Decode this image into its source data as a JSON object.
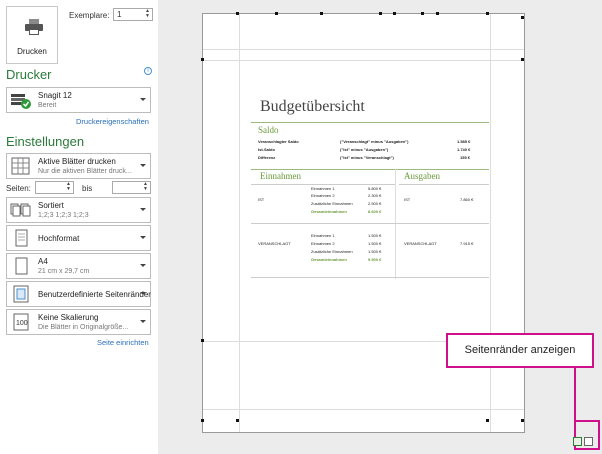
{
  "print": {
    "button_label": "Drucken",
    "copies_label": "Exemplare:",
    "copies_value": "1"
  },
  "printer": {
    "section_title": "Drucker",
    "info_icon": "info-icon",
    "name": "Snagit 12",
    "status": "Bereit",
    "properties_link": "Druckereigenschaften"
  },
  "settings": {
    "section_title": "Einstellungen",
    "scope": {
      "title": "Aktive Blätter drucken",
      "subtitle": "Nur die aktiven Blätter druck..."
    },
    "pages_label": "Seiten:",
    "pages_from": "",
    "to_label": "bis",
    "pages_to": "",
    "collate": {
      "title": "Sortiert",
      "subtitle": "1;2;3    1;2;3    1;2;3"
    },
    "orientation": {
      "title": "Hochformat"
    },
    "paper": {
      "title": "A4",
      "subtitle": "21  cm x 29,7  cm"
    },
    "margins": {
      "title": "Benutzerdefinierte Seitenränder"
    },
    "scaling": {
      "title": "Keine Skalierung",
      "subtitle": "Die Blätter in Originalgröße..."
    },
    "page_setup_link": "Seite einrichten"
  },
  "preview": {
    "doc_title": "Budgetübersicht",
    "saldo": {
      "heading": "Saldo",
      "rows": [
        {
          "label": "Veranschlagter Saldo",
          "formula": "(\"Veranschlagt\" minus \"Ausgaben\")",
          "value": "1.585 €"
        },
        {
          "label": "Ist-Saldo",
          "formula": "(\"Ist\" minus \"Ausgaben\")",
          "value": "1.740 €"
        },
        {
          "label": "Differenz",
          "formula": "(\"Ist\" minus \"Veranschlagt\")",
          "value": "155 €"
        }
      ]
    },
    "income_heading": "Einnahmen",
    "expenses_heading": "Ausgaben",
    "ist": {
      "label": "IST",
      "items": [
        {
          "label": "Einnahmen 1",
          "value": "5.800 €"
        },
        {
          "label": "Einnahmen 2",
          "value": "2.300 €"
        },
        {
          "label": "Zusätzliche Einnahmen",
          "value": "2.500 €"
        }
      ],
      "total_label": "Gesamteinnahmen",
      "total_value": "8.600 €",
      "expense_label": "IST",
      "expense_value": "7.860 €"
    },
    "veranschlagt": {
      "label": "VERANSCHLAGT",
      "items": [
        {
          "label": "Einnahmen 1",
          "value": "1.500 €"
        },
        {
          "label": "Einnahmen 2",
          "value": "1.500 €"
        },
        {
          "label": "Zusätzliche Einnahmen",
          "value": "1.500 €"
        }
      ],
      "total_label": "Gesamteinnahmen",
      "total_value": "9.500 €",
      "expense_label": "VERANSCHLAGT",
      "expense_value": "7.915 €"
    }
  },
  "callout": {
    "text": "Seitenränder anzeigen"
  },
  "colors": {
    "accent_green": "#2b7a3a",
    "callout_magenta": "#d0108a",
    "link_blue": "#2a6ebb"
  }
}
